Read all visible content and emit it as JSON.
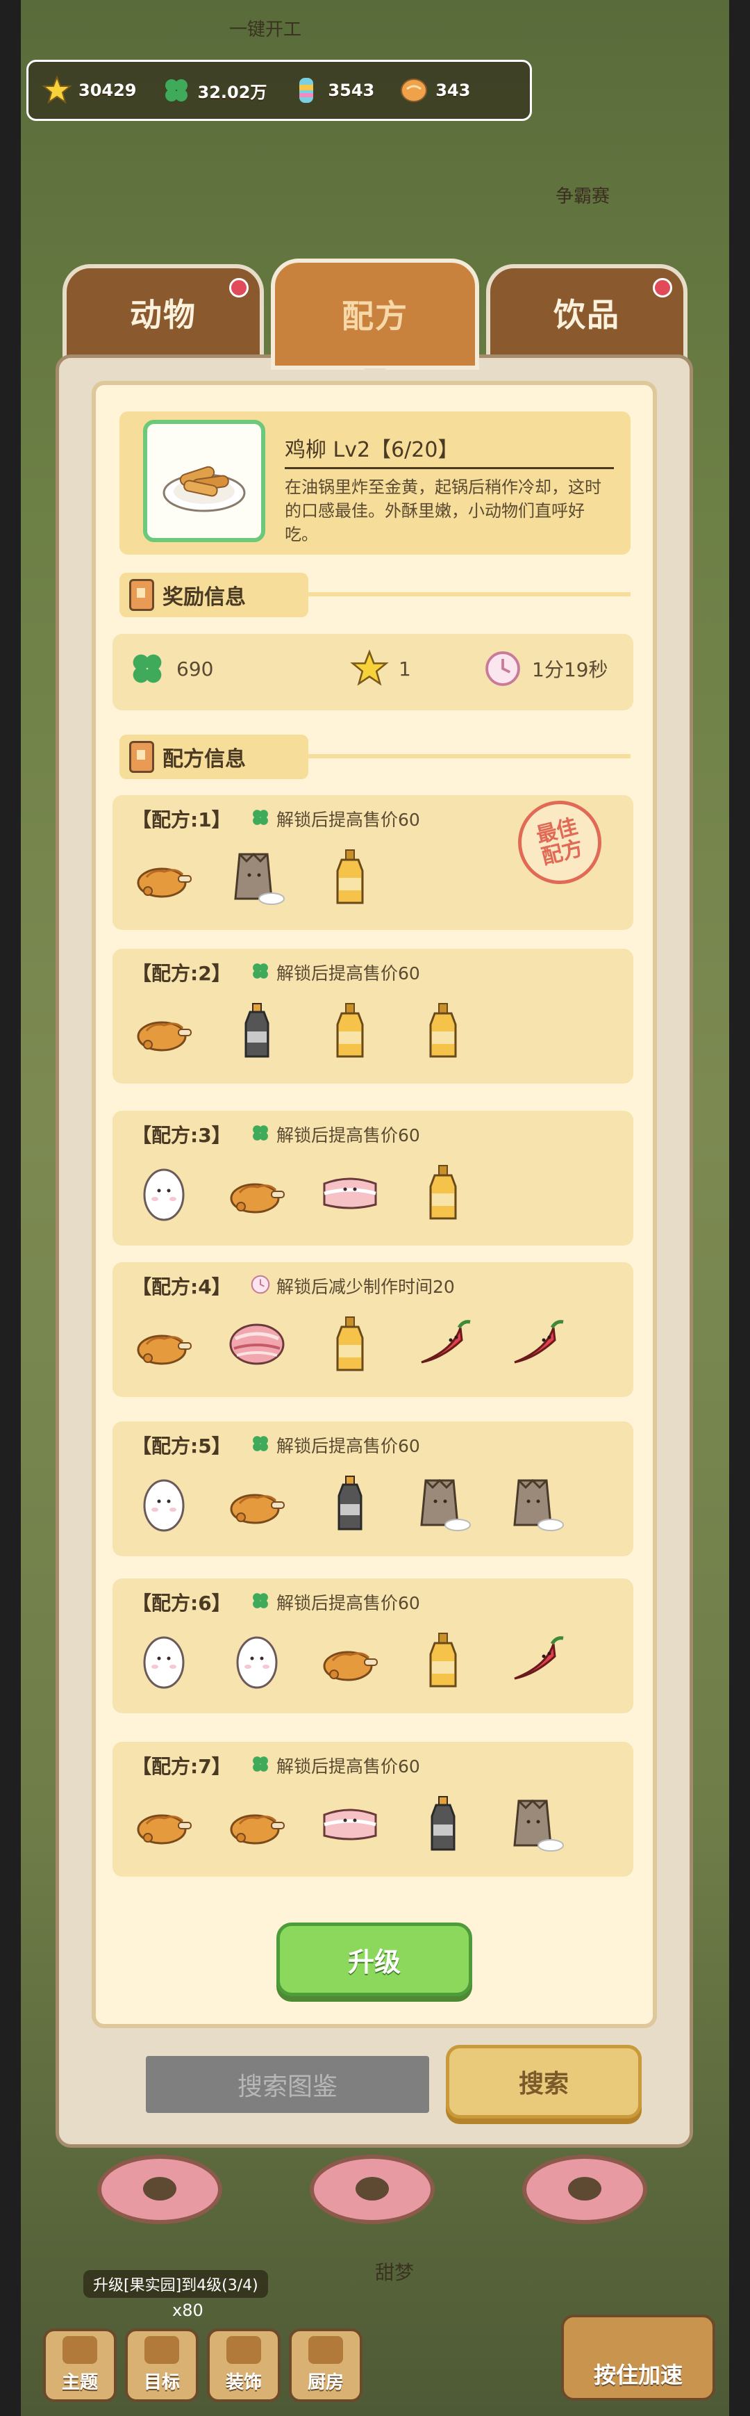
{
  "top": {
    "partial_label": "一键开工",
    "deco_label": "争霸赛"
  },
  "currency": [
    {
      "icon": "star-icon",
      "value": "30429"
    },
    {
      "icon": "clover-icon",
      "value": "32.02万"
    },
    {
      "icon": "candy-icon",
      "value": "3543"
    },
    {
      "icon": "coin-icon",
      "value": "343"
    }
  ],
  "tabs": [
    {
      "label": "动物",
      "active": false,
      "has_dot": true
    },
    {
      "label": "配方",
      "active": true,
      "has_dot": false
    },
    {
      "label": "饮品",
      "active": false,
      "has_dot": true
    }
  ],
  "item": {
    "title": "鸡柳 Lv2【6/20】",
    "description": "在油锅里炸至金黄，起锅后稍作冷却，这时的口感最佳。外酥里嫩，小动物们直呼好吃。",
    "icon": "chicken-strips-icon"
  },
  "reward_section": {
    "title": "奖励信息",
    "clover": "690",
    "star": "1",
    "time": "1分19秒"
  },
  "recipe_section": {
    "title": "配方信息",
    "best_stamp": "最佳配方",
    "recipes": [
      {
        "label": "【配方:1】",
        "cond_icon": "clover-icon",
        "cond": "解锁后提高售价60",
        "best": true,
        "ingredients": [
          "roast-chicken-icon",
          "flour-bag-icon",
          "oil-bottle-icon"
        ]
      },
      {
        "label": "【配方:2】",
        "cond_icon": "clover-icon",
        "cond": "解锁后提高售价60",
        "best": false,
        "ingredients": [
          "roast-chicken-icon",
          "soy-sauce-icon",
          "oil-bottle-icon",
          "oil-bottle-icon"
        ]
      },
      {
        "label": "【配方:3】",
        "cond_icon": "clover-icon",
        "cond": "解锁后提高售价60",
        "best": false,
        "ingredients": [
          "egg-icon",
          "roast-chicken-icon",
          "pork-belly-icon",
          "oil-bottle-icon"
        ]
      },
      {
        "label": "【配方:4】",
        "cond_icon": "clock-icon",
        "cond": "解锁后减少制作时间20",
        "best": false,
        "ingredients": [
          "roast-chicken-icon",
          "bacon-icon",
          "oil-bottle-icon",
          "chili-icon",
          "chili-icon"
        ]
      },
      {
        "label": "【配方:5】",
        "cond_icon": "clover-icon",
        "cond": "解锁后提高售价60",
        "best": false,
        "ingredients": [
          "egg-icon",
          "roast-chicken-icon",
          "soy-sauce-icon",
          "flour-bag-icon",
          "flour-bag-icon"
        ]
      },
      {
        "label": "【配方:6】",
        "cond_icon": "clover-icon",
        "cond": "解锁后提高售价60",
        "best": false,
        "ingredients": [
          "egg-icon",
          "egg-icon",
          "roast-chicken-icon",
          "oil-bottle-icon",
          "chili-icon"
        ]
      },
      {
        "label": "【配方:7】",
        "cond_icon": "clover-icon",
        "cond": "解锁后提高售价60",
        "best": false,
        "ingredients": [
          "roast-chicken-icon",
          "roast-chicken-icon",
          "pork-belly-icon",
          "soy-sauce-icon",
          "flour-bag-icon"
        ]
      }
    ]
  },
  "buttons": {
    "upgrade": "升级",
    "search_placeholder": "搜索图鉴",
    "search": "搜索"
  },
  "bottom": {
    "upgrade_info": "升级[果实园]到4级(3/4)",
    "speed": "x80",
    "dream": "甜梦",
    "nav": [
      "主题",
      "目标",
      "装饰",
      "厨房"
    ],
    "hold_speed": "按住加速"
  }
}
